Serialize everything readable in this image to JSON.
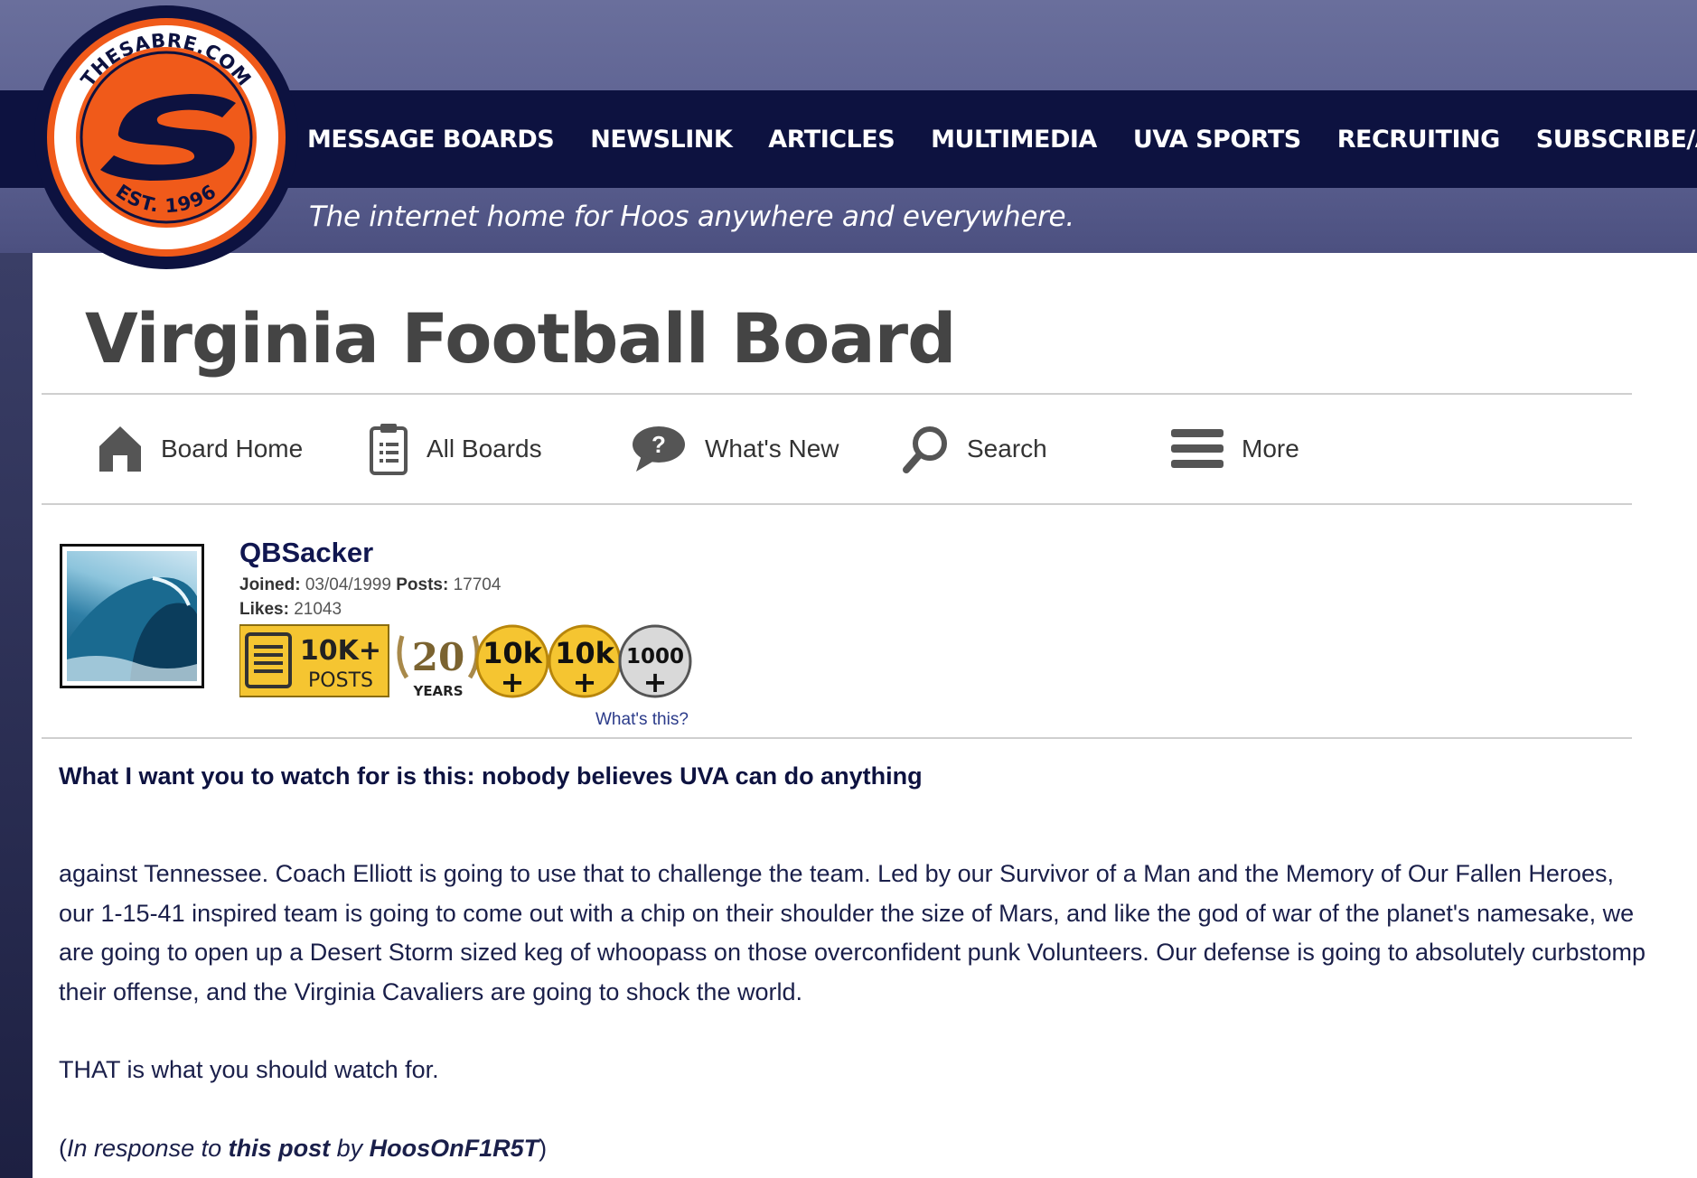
{
  "site": {
    "logo_ring_text": "THESABRE.COM",
    "logo_est": "EST. 1996",
    "tagline": "The internet home for Hoos anywhere and everywhere.",
    "nav": [
      "MESSAGE BOARDS",
      "NEWSLINK",
      "ARTICLES",
      "MULTIMEDIA",
      "UVA SPORTS",
      "RECRUITING",
      "SUBSCRIBE/A"
    ]
  },
  "board": {
    "title": "Virginia Football Board",
    "toolbar": {
      "board_home": "Board Home",
      "all_boards": "All Boards",
      "whats_new": "What's New",
      "search": "Search",
      "more": "More"
    }
  },
  "user": {
    "name": "QBSacker",
    "joined_label": "Joined:",
    "joined": "03/04/1999",
    "posts_label": "Posts:",
    "posts": "17704",
    "likes_label": "Likes:",
    "likes": "21043",
    "badges": {
      "posts_top": "10K+",
      "posts_bottom": "POSTS",
      "years_num": "20",
      "years_label": "YEARS",
      "likes1_top": "10k",
      "likes2_top": "10k",
      "silver_top": "1000",
      "plus": "+"
    },
    "whats_this": "What's this?"
  },
  "post": {
    "title": "What I want you to watch for is this: nobody believes UVA can do anything",
    "para1": "against Tennessee. Coach Elliott is going to use that to challenge the team. Led by our Survivor of a Man and the Memory of Our Fallen Heroes, our 1-15-41 inspired team is going to come out with a chip on their shoulder the size of Mars, and like the god of war of the planet's namesake, we are going to open up a Desert Storm sized keg of whoopass on those overconfident punk Volunteers. Our defense is going to absolutely curbstomp their offense, and the Virginia Cavaliers are going to shock the world.",
    "para2": "THAT is what you should watch for.",
    "resp_open": "(",
    "resp_prefix": "In response to ",
    "resp_link": "this post",
    "resp_by": " by ",
    "resp_author": "HoosOnF1R5T",
    "resp_close": ")"
  },
  "colors": {
    "navy": "#0d1240",
    "orange": "#f05a1a",
    "gold": "#f5c531"
  }
}
